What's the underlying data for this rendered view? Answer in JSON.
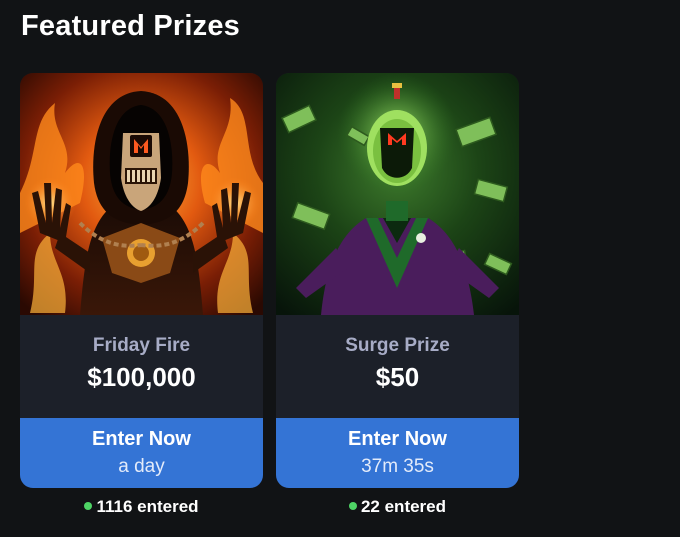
{
  "section": {
    "title": "Featured Prizes"
  },
  "cards": [
    {
      "name": "Friday Fire",
      "value": "$100,000",
      "enter_label": "Enter Now",
      "timer": "a day",
      "entered": "1116 entered",
      "image_theme": "fire-hooded-figure"
    },
    {
      "name": "Surge Prize",
      "value": "$50",
      "enter_label": "Enter Now",
      "timer": "37m 35s",
      "entered": "22 entered",
      "image_theme": "green-money-figure"
    }
  ],
  "colors": {
    "background": "#111315",
    "card_info": "#1c2029",
    "accent_button": "#3474d5",
    "prize_name": "#a7acc6",
    "status_dot": "#4ed465"
  }
}
